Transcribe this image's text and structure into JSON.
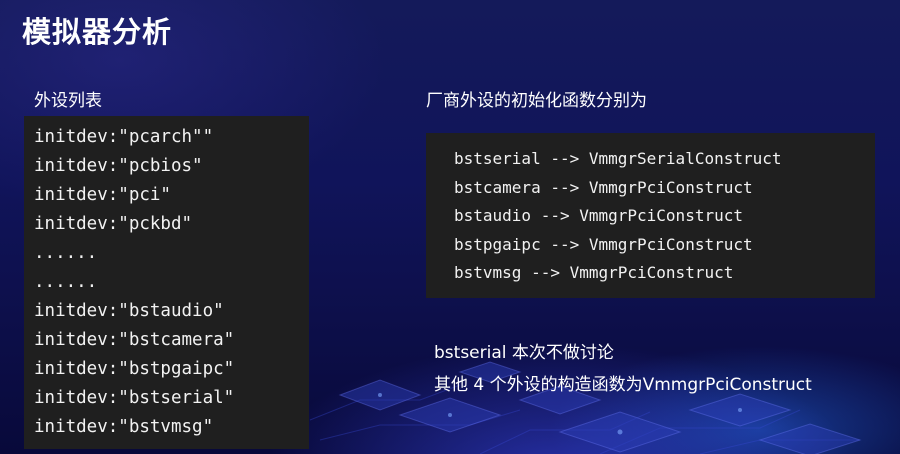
{
  "title": "模拟器分析",
  "left_section": {
    "label": "外设列表",
    "lines": [
      "initdev:\"pcarch\"\"",
      "initdev:\"pcbios\"",
      "initdev:\"pci\"",
      "initdev:\"pckbd\"",
      "......",
      "......",
      "initdev:\"bstaudio\"",
      "initdev:\"bstcamera\"",
      "initdev:\"bstpgaipc\"",
      "initdev:\"bstserial\"",
      "initdev:\"bstvmsg\""
    ]
  },
  "right_section": {
    "label": "厂商外设的初始化函数分别为",
    "lines": [
      "bstserial --> VmmgrSerialConstruct",
      "bstcamera --> VmmgrPciConstruct",
      "bstaudio --> VmmgrPciConstruct",
      "bstpgaipc --> VmmgrPciConstruct",
      "bstvmsg --> VmmgrPciConstruct"
    ]
  },
  "notes": {
    "line1": "bstserial 本次不做讨论",
    "line2": "其他 4 个外设的构造函数为VmmgrPciConstruct"
  },
  "colors": {
    "background": "#10145a",
    "code_panel": "#1f1f1f",
    "text": "#ffffff",
    "accent_glow": "#4050ff"
  }
}
